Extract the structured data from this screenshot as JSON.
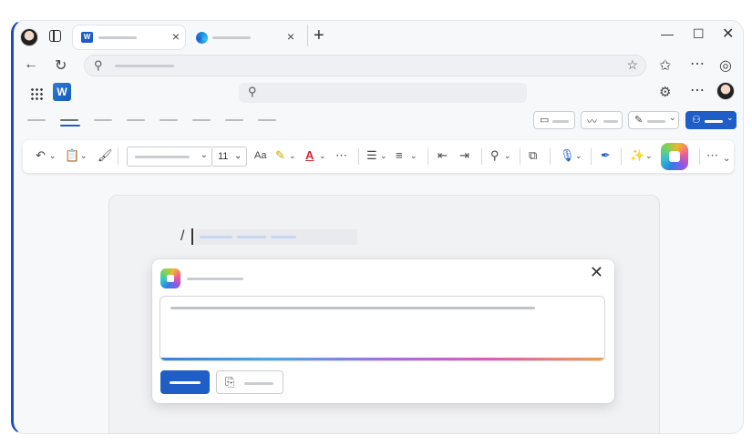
{
  "toolbar": {
    "font_size": "11"
  },
  "colors": {
    "brand_blue": "#1f5ec7",
    "frame_accent": "#1e4fb3",
    "word_blue": "#185abd"
  },
  "icons": {
    "tab_strip": [
      "profile-avatar-icon",
      "tab-manager-icon",
      "word-tab-icon",
      "close-icon",
      "edge-tab-icon",
      "close-icon",
      "new-tab-icon",
      "minimize-icon",
      "maximize-icon",
      "close-window-icon"
    ],
    "navigation": [
      "back-arrow-icon",
      "refresh-icon",
      "search-icon",
      "favorite-star-icon",
      "favorites-icon",
      "more-icon",
      "copilot-sidebar-icon"
    ],
    "app_header": [
      "app-launcher-icon",
      "word-logo-icon",
      "search-icon",
      "settings-gear-icon",
      "more-icon",
      "avatar-icon"
    ],
    "ribbon_chips": [
      "comments-icon",
      "activity-icon",
      "editing-pen-icon",
      "share-icon"
    ],
    "toolbar": [
      "undo-icon",
      "paste-icon",
      "format-painter-icon",
      "change-case-icon",
      "highlighter-icon",
      "font-color-icon",
      "more-icon",
      "bullets-icon",
      "align-icon",
      "decrease-indent-icon",
      "increase-indent-icon",
      "find-icon",
      "reuse-file-icon",
      "dictate-mic-icon",
      "editor-icon",
      "designer-icon",
      "copilot-icon",
      "overflow-icon"
    ],
    "dialog": [
      "copilot-icon",
      "close-icon",
      "reference-file-icon"
    ]
  }
}
